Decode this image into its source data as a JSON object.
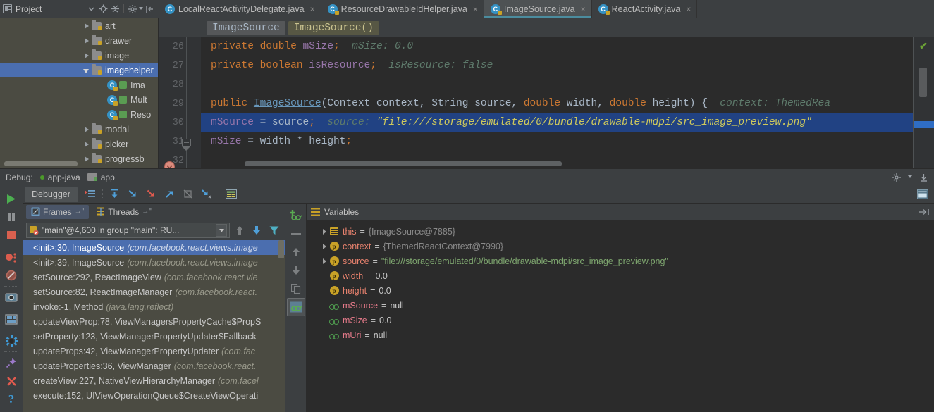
{
  "project_toolbar": {
    "title": "Project",
    "icons": [
      "chevron-down-icon",
      "locate-icon",
      "collapse-all-icon",
      "settings-icon",
      "hide-icon"
    ]
  },
  "editor_tabs": [
    {
      "label": "LocalReactActivityDelegate.java",
      "icon": "java-class-icon",
      "active": false,
      "closable": true
    },
    {
      "label": "ResourceDrawableIdHelper.java",
      "icon": "java-class-icon",
      "active": false,
      "closable": true
    },
    {
      "label": "ImageSource.java",
      "icon": "java-class-icon",
      "active": true,
      "closable": true
    },
    {
      "label": "ReactActivity.java",
      "icon": "java-class-icon",
      "active": false,
      "closable": true
    }
  ],
  "tree": {
    "nodes": [
      {
        "label": "art",
        "type": "folder",
        "state": "collapsed",
        "indent": 0,
        "selected": false
      },
      {
        "label": "drawer",
        "type": "folder",
        "state": "collapsed",
        "indent": 0,
        "selected": false
      },
      {
        "label": "image",
        "type": "folder",
        "state": "collapsed",
        "indent": 0,
        "selected": false
      },
      {
        "label": "imagehelper",
        "type": "folder",
        "state": "expanded",
        "indent": 0,
        "selected": true
      },
      {
        "label": "Ima",
        "type": "class",
        "state": "leaf",
        "indent": 1,
        "selected": false
      },
      {
        "label": "Mult",
        "type": "class",
        "state": "leaf",
        "indent": 1,
        "selected": false
      },
      {
        "label": "Reso",
        "type": "class",
        "state": "leaf",
        "indent": 1,
        "selected": false
      },
      {
        "label": "modal",
        "type": "folder",
        "state": "collapsed",
        "indent": 0,
        "selected": false
      },
      {
        "label": "picker",
        "type": "folder",
        "state": "collapsed",
        "indent": 0,
        "selected": false
      },
      {
        "label": "progressb",
        "type": "folder",
        "state": "collapsed",
        "indent": 0,
        "selected": false
      }
    ]
  },
  "breadcrumb": {
    "class": "ImageSource",
    "method": "ImageSource()"
  },
  "editor": {
    "line_numbers": [
      "26",
      "27",
      "28",
      "29",
      "30",
      "31",
      "32"
    ],
    "lines": [
      {
        "n": "26",
        "segments": [
          {
            "t": "private",
            "c": "kw"
          },
          {
            "t": " ",
            "c": "pl"
          },
          {
            "t": "double",
            "c": "kw"
          },
          {
            "t": " mSize",
            "c": "fld"
          },
          {
            "t": ";",
            "c": "sem"
          },
          {
            "t": "  ",
            "c": "pl"
          },
          {
            "t": "mSize: 0.0",
            "c": "hint"
          }
        ]
      },
      {
        "n": "27",
        "segments": [
          {
            "t": "private",
            "c": "kw"
          },
          {
            "t": " ",
            "c": "pl"
          },
          {
            "t": "boolean",
            "c": "kw"
          },
          {
            "t": " isResource",
            "c": "fld"
          },
          {
            "t": ";",
            "c": "sem"
          },
          {
            "t": "  ",
            "c": "pl"
          },
          {
            "t": "isResource: false",
            "c": "hint"
          }
        ]
      },
      {
        "n": "28",
        "segments": []
      },
      {
        "n": "29",
        "segments": [
          {
            "t": "public",
            "c": "kw"
          },
          {
            "t": " ",
            "c": "pl"
          },
          {
            "t": "ImageSource",
            "c": "mname"
          },
          {
            "t": "(Context context, ",
            "c": "pl"
          },
          {
            "t": "String",
            "c": "pl"
          },
          {
            "t": " source, ",
            "c": "pl"
          },
          {
            "t": "double",
            "c": "kw"
          },
          {
            "t": " width, ",
            "c": "pl"
          },
          {
            "t": "double",
            "c": "kw"
          },
          {
            "t": " height) {",
            "c": "pl"
          },
          {
            "t": "  context: ThemedRea",
            "c": "hint"
          }
        ]
      },
      {
        "n": "30",
        "highlight": true,
        "breakpoint": true,
        "segments": [
          {
            "t": "mSource",
            "c": "fld"
          },
          {
            "t": " = source",
            "c": "pl"
          },
          {
            "t": ";",
            "c": "sem"
          },
          {
            "t": "  ",
            "c": "pl"
          },
          {
            "t": "source:",
            "c": "hint"
          },
          {
            "t": " ",
            "c": "pl"
          },
          {
            "t": "\"file:///storage/emulated/0/bundle/drawable-mdpi/src_image_preview.png\"",
            "c": "str"
          }
        ]
      },
      {
        "n": "31",
        "segments": [
          {
            "t": "mSize",
            "c": "fld"
          },
          {
            "t": " = width * height",
            "c": "pl"
          },
          {
            "t": ";",
            "c": "sem"
          }
        ]
      },
      {
        "n": "32",
        "segments": []
      }
    ],
    "inspection_status": "ok-check-icon"
  },
  "debug_bar": {
    "label": "Debug:",
    "config_name": "app-java",
    "module_name": "app",
    "right_icons": [
      "settings-icon",
      "hide-icon"
    ]
  },
  "debugger": {
    "tab_label": "Debugger",
    "step_buttons": [
      "show-execution-point-icon",
      "step-over-icon",
      "step-into-icon",
      "force-step-into-icon",
      "step-out-icon",
      "drop-frame-icon",
      "run-to-cursor-icon",
      "evaluate-expression-icon"
    ],
    "left_rail_buttons": [
      "resume-program-icon",
      "pause-program-icon",
      "stop-icon",
      "view-breakpoints-icon",
      "mute-breakpoints-icon",
      "screenshot-icon",
      "layout-inspector-icon",
      "settings-icon",
      "pin-icon",
      "close-icon",
      "help-icon"
    ],
    "restore_layout_icon": "restore-layout-icon"
  },
  "frames": {
    "tabs": [
      {
        "label": "Frames",
        "icon": "frames-icon",
        "active": true
      },
      {
        "label": "Threads",
        "icon": "threads-icon",
        "active": false
      }
    ],
    "thread_selector": "\"main\"@4,600 in group \"main\": RU...",
    "toolbar_icons": [
      "arrow-up-icon",
      "arrow-down-icon",
      "filter-icon"
    ],
    "rows": [
      {
        "method": "<init>:30, ImageSource",
        "package": "(com.facebook.react.views.image",
        "selected": true
      },
      {
        "method": "<init>:39, ImageSource",
        "package": "(com.facebook.react.views.image",
        "selected": false
      },
      {
        "method": "setSource:292, ReactImageView",
        "package": "(com.facebook.react.vie",
        "selected": false
      },
      {
        "method": "setSource:82, ReactImageManager",
        "package": "(com.facebook.react.",
        "selected": false
      },
      {
        "method": "invoke:-1, Method",
        "package": "(java.lang.reflect)",
        "selected": false
      },
      {
        "method": "updateViewProp:78, ViewManagersPropertyCache$PropS",
        "package": "",
        "selected": false
      },
      {
        "method": "setProperty:123, ViewManagerPropertyUpdater$Fallback",
        "package": "",
        "selected": false
      },
      {
        "method": "updateProps:42, ViewManagerPropertyUpdater",
        "package": "(com.fac",
        "selected": false
      },
      {
        "method": "updateProperties:36, ViewManager",
        "package": "(com.facebook.react.",
        "selected": false
      },
      {
        "method": "createView:227, NativeViewHierarchyManager",
        "package": "(com.facel",
        "selected": false
      },
      {
        "method": "execute:152, UIViewOperationQueue$CreateViewOperati",
        "package": "",
        "selected": false
      }
    ]
  },
  "variables": {
    "title": "Variables",
    "title_icon": "variables-icon",
    "mid_rail_icons": [
      "add-watch-icon",
      "remove-icon",
      "up-icon",
      "down-icon",
      "copy-icon",
      "inspect-icon"
    ],
    "rows": [
      {
        "expandable": true,
        "icon": "object-icon",
        "name": "this",
        "value": "{ImageSource@7885}",
        "value_kind": "dim",
        "indent": 0
      },
      {
        "expandable": true,
        "icon": "parameter-icon",
        "name": "context",
        "value": "{ThemedReactContext@7990}",
        "value_kind": "dim",
        "indent": 0
      },
      {
        "expandable": true,
        "icon": "parameter-icon",
        "name": "source",
        "value": "\"file:///storage/emulated/0/bundle/drawable-mdpi/src_image_preview.png\"",
        "value_kind": "str",
        "indent": 0
      },
      {
        "expandable": false,
        "icon": "parameter-icon",
        "name": "width",
        "value": "0.0",
        "value_kind": "num",
        "indent": 0
      },
      {
        "expandable": false,
        "icon": "parameter-icon",
        "name": "height",
        "value": "0.0",
        "value_kind": "num",
        "indent": 0
      },
      {
        "expandable": false,
        "icon": "field-icon",
        "name": "mSource",
        "value": "null",
        "value_kind": "num",
        "indent": 0
      },
      {
        "expandable": false,
        "icon": "field-icon",
        "name": "mSize",
        "value": "0.0",
        "value_kind": "num",
        "indent": 0
      },
      {
        "expandable": false,
        "icon": "field-icon",
        "name": "mUri",
        "value": "null",
        "value_kind": "num",
        "indent": 0
      }
    ]
  },
  "colors": {
    "chrome": "#3c3f41",
    "editor_bg": "#2b2b2b",
    "tree_bg": "#4b4b42",
    "selection_blue": "#4b6eaf",
    "line_highlight": "#214283",
    "accent_teal": "#4b8c9e",
    "string_yellow": "#cfc95c",
    "keyword_orange": "#cc7832",
    "field_purple": "#9876aa",
    "hint_green": "#5e7a6b"
  }
}
